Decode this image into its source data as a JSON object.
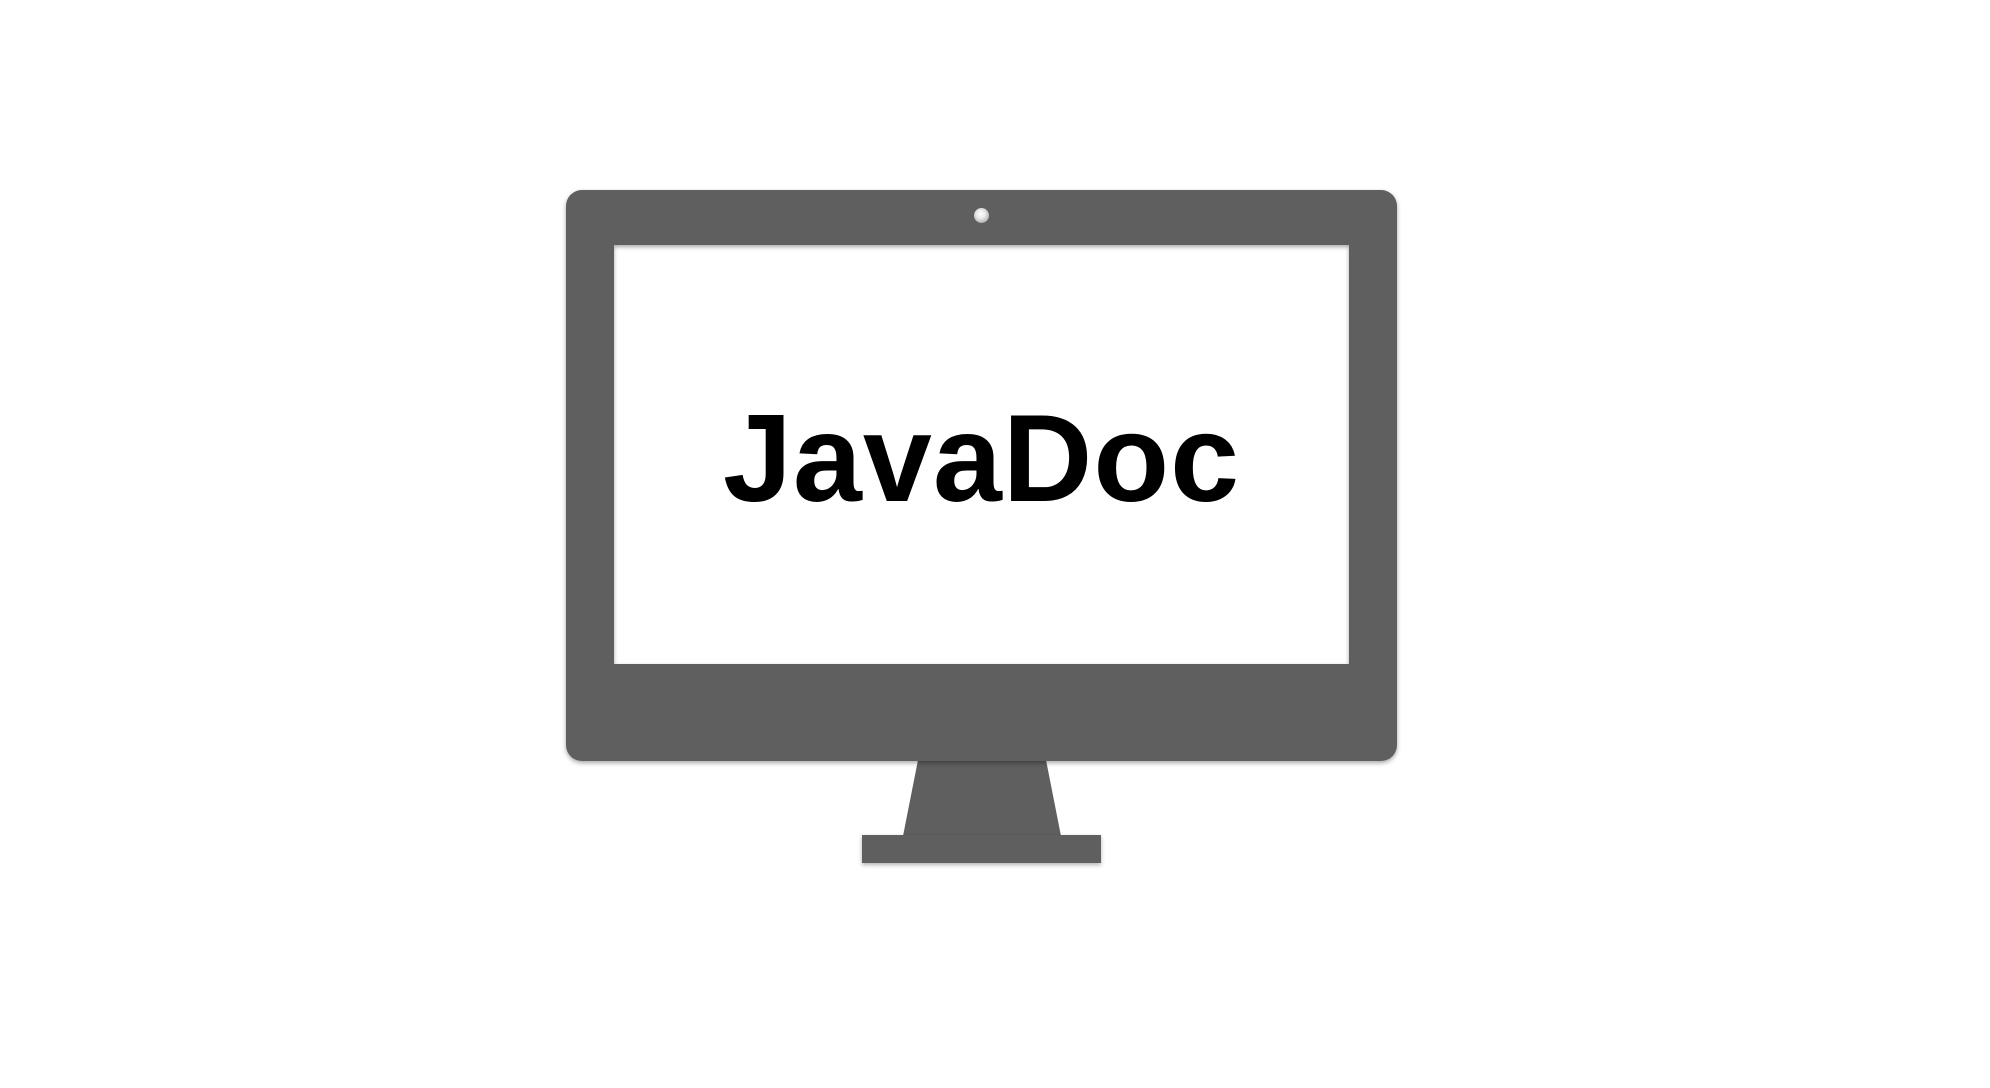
{
  "screen": {
    "title": "JavaDoc"
  },
  "icons": {
    "monitor": "monitor-icon",
    "camera": "camera-icon"
  },
  "colors": {
    "bezel": "#5f5f5f",
    "screen": "#ffffff",
    "text": "#000000"
  }
}
